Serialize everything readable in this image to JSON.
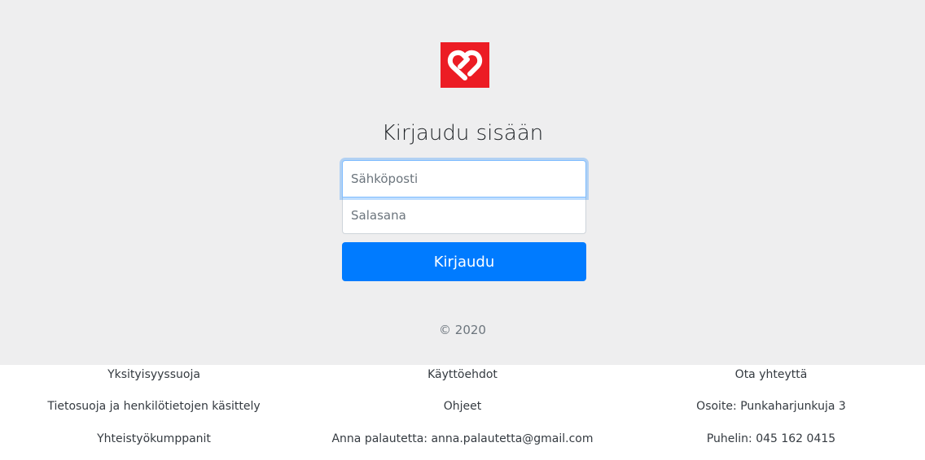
{
  "login": {
    "title": "Kirjaudu sisään",
    "email_placeholder": "Sähköposti",
    "password_placeholder": "Salasana",
    "submit_label": "Kirjaudu",
    "copyright": "© 2020",
    "logo_icon": "heart-link-logo-icon"
  },
  "footer": {
    "col1": [
      "Yksityisyyssuoja",
      "Tietosuoja ja henkilötietojen käsittely",
      "Yhteistyökumppanit"
    ],
    "col2": [
      "Käyttöehdot",
      "Ohjeet",
      "Anna palautetta: anna.palautetta@gmail.com"
    ],
    "col3": [
      "Ota yhteyttä",
      "Osoite: Punkaharjunkuja 3",
      "Puhelin: 045 162 0415"
    ]
  },
  "colors": {
    "page_background": "#eeeeef",
    "logo_red": "#ec1c24",
    "primary_button": "#007bff",
    "footer_background": "#ffffff"
  }
}
